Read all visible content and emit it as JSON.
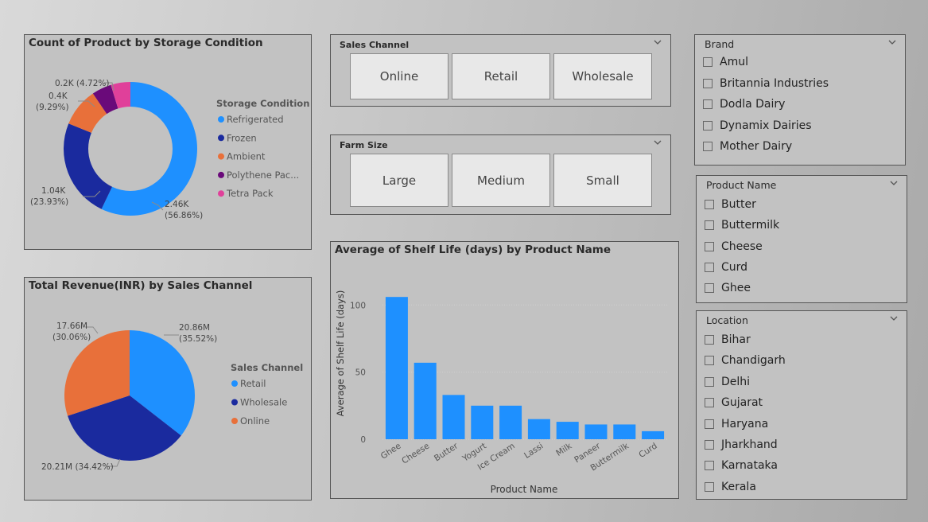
{
  "colors": {
    "blue": "#1e90ff",
    "navy": "#1a2a9e",
    "orange": "#e8703a",
    "purple": "#6a0a7a",
    "pink": "#e0409a"
  },
  "donut": {
    "title": "Count of Product by Storage Condition",
    "legend_title": "Storage Condition",
    "legend": [
      "Refrigerated",
      "Frozen",
      "Ambient",
      "Polythene Pac...",
      "Tetra Pack"
    ],
    "labels": {
      "tetra_a": "0.2K (4.72%)",
      "poly_a": "0.4K",
      "poly_b": "(9.29%)",
      "frozen_a": "1.04K",
      "frozen_b": "(23.93%)",
      "refrig_a": "2.46K",
      "refrig_b": "(56.86%)"
    }
  },
  "pie": {
    "title": "Total Revenue(INR) by Sales Channel",
    "legend_title": "Sales Channel",
    "legend": [
      "Retail",
      "Wholesale",
      "Online"
    ],
    "labels": {
      "online_a": "17.66M",
      "online_b": "(30.06%)",
      "retail_a": "20.86M",
      "retail_b": "(35.52%)",
      "wholesale": "20.21M (34.42%)"
    }
  },
  "sales_slicer": {
    "title": "Sales Channel",
    "options": [
      "Online",
      "Retail",
      "Wholesale"
    ]
  },
  "farm_slicer": {
    "title": "Farm Size",
    "options": [
      "Large",
      "Medium",
      "Small"
    ]
  },
  "brand_slicer": {
    "title": "Brand",
    "items": [
      "Amul",
      "Britannia Industries",
      "Dodla Dairy",
      "Dynamix Dairies",
      "Mother Dairy"
    ]
  },
  "product_slicer": {
    "title": "Product Name",
    "items": [
      "Butter",
      "Buttermilk",
      "Cheese",
      "Curd",
      "Ghee"
    ]
  },
  "location_slicer": {
    "title": "Location",
    "items": [
      "Bihar",
      "Chandigarh",
      "Delhi",
      "Gujarat",
      "Haryana",
      "Jharkhand",
      "Karnataka",
      "Kerala"
    ]
  },
  "chart_data": [
    {
      "type": "pie",
      "title": "Count of Product by Storage Condition",
      "categories": [
        "Refrigerated",
        "Frozen",
        "Ambient",
        "Polythene Pac...",
        "Tetra Pack"
      ],
      "values": [
        2460,
        1040,
        400,
        200,
        200
      ],
      "percent": [
        56.86,
        23.93,
        9.29,
        4.72,
        4.72
      ],
      "donut": true
    },
    {
      "type": "pie",
      "title": "Total Revenue(INR) by Sales Channel",
      "categories": [
        "Retail",
        "Wholesale",
        "Online"
      ],
      "values": [
        20.86,
        20.21,
        17.66
      ],
      "percent": [
        35.52,
        34.42,
        30.06
      ]
    },
    {
      "type": "bar",
      "title": "Average of Shelf Life (days) by Product Name",
      "xlabel": "Product Name",
      "ylabel": "Average of Shelf Life (days)",
      "categories": [
        "Ghee",
        "Cheese",
        "Butter",
        "Yogurt",
        "Ice Cream",
        "Lassi",
        "Milk",
        "Paneer",
        "Buttermilk",
        "Curd"
      ],
      "values": [
        106,
        57,
        33,
        25,
        25,
        15,
        13,
        11,
        11,
        6
      ],
      "ylim": [
        0,
        115
      ],
      "yticks": [
        "0",
        "50",
        "100"
      ],
      "grid": true
    }
  ]
}
